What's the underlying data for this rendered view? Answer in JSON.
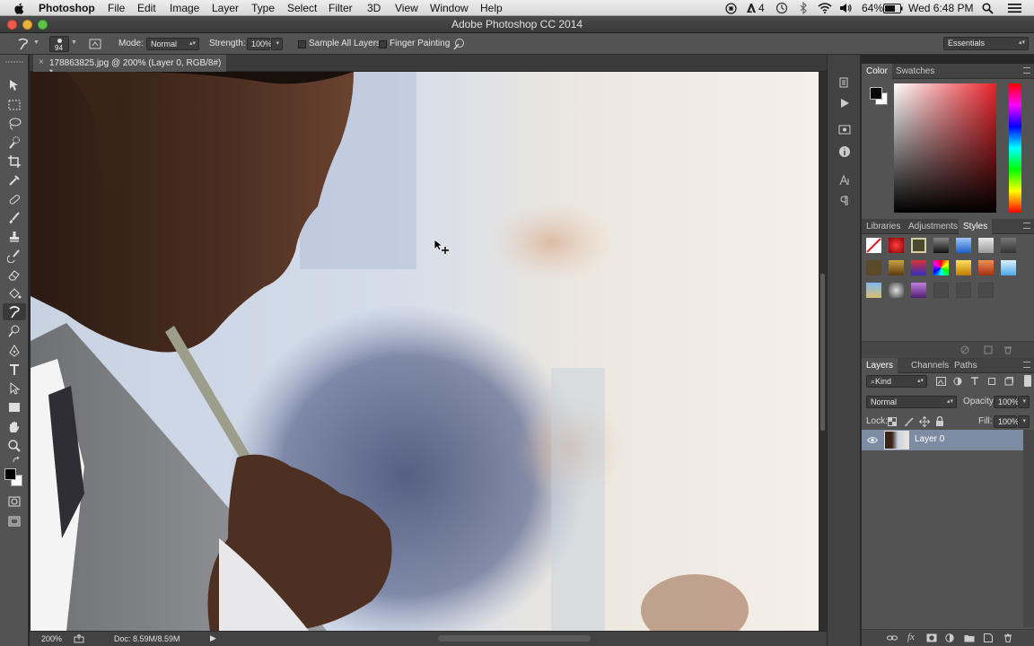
{
  "menubar": {
    "app": "Photoshop",
    "items": [
      "File",
      "Edit",
      "Image",
      "Layer",
      "Type",
      "Select",
      "Filter",
      "3D",
      "View",
      "Window",
      "Help"
    ],
    "status_num": "4",
    "battery": "64%",
    "clock": "Wed 6:48 PM"
  },
  "window": {
    "title": "Adobe Photoshop CC 2014"
  },
  "options": {
    "brush_size": "94",
    "mode_label": "Mode:",
    "mode_value": "Normal",
    "strength_label": "Strength:",
    "strength_value": "100%",
    "sample_all_label": "Sample All Layers",
    "finger_label": "Finger Painting",
    "workspace": "Essentials"
  },
  "document": {
    "tab_title": "178863825.jpg @ 200% (Layer 0, RGB/8#) *",
    "zoom": "200%",
    "doc_info": "Doc: 8.59M/8.59M"
  },
  "color_panel": {
    "tabs": [
      "Color",
      "Swatches"
    ]
  },
  "styles_panel": {
    "tabs": [
      "Libraries",
      "Adjustments",
      "Styles"
    ]
  },
  "layers_panel": {
    "tabs": [
      "Layers",
      "Channels",
      "Paths"
    ],
    "filter_value": "Kind",
    "blend_mode": "Normal",
    "opacity_label": "Opacity:",
    "opacity_value": "100%",
    "lock_label": "Lock:",
    "fill_label": "Fill:",
    "fill_value": "100%",
    "layer_name": "Layer 0"
  },
  "colors": {
    "accent": "#7d8ca3",
    "panel": "#535353",
    "dark": "#282828"
  }
}
